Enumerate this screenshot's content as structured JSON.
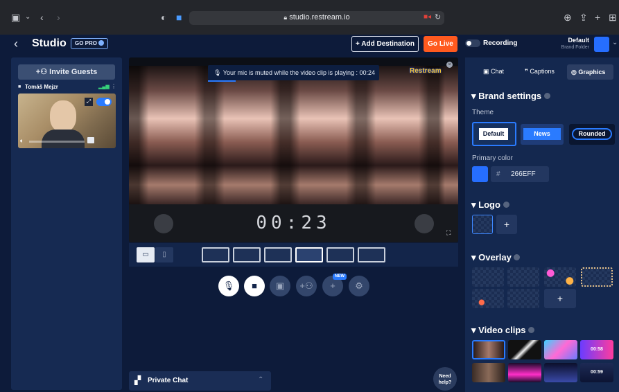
{
  "browser": {
    "url": "studio.restream.io"
  },
  "topbar": {
    "title": "Studio",
    "go_pro": "GO PRO",
    "add_destination": "+ Add Destination",
    "go_live": "Go Live",
    "recording": "Recording",
    "brand_name": "Default",
    "brand_folder": "Brand Folder"
  },
  "left": {
    "invite": "Invite Guests",
    "guest_name": "Tomáš Mejzr"
  },
  "stage": {
    "notice": "Your mic is muted while the video clip is playing : 00:24",
    "watermark": "Restream",
    "timer": "00:23"
  },
  "controls": {
    "new_badge": "NEW"
  },
  "private_chat": {
    "label": "Private Chat"
  },
  "need_help": {
    "line1": "Need",
    "line2": "help?"
  },
  "right": {
    "tabs": [
      "Chat",
      "Captions",
      "Graphics"
    ],
    "brand_settings": "Brand settings",
    "theme_label": "Theme",
    "themes": [
      "Default",
      "News",
      "Rounded"
    ],
    "primary_color_label": "Primary color",
    "hash": "#",
    "primary_color_value": "266EFF",
    "primary_color_hex": "#266eff",
    "logo": "Logo",
    "overlay": "Overlay",
    "video_clips": "Video clips",
    "clip_duration_1": "00:58",
    "clip_duration_2": "00:59"
  }
}
